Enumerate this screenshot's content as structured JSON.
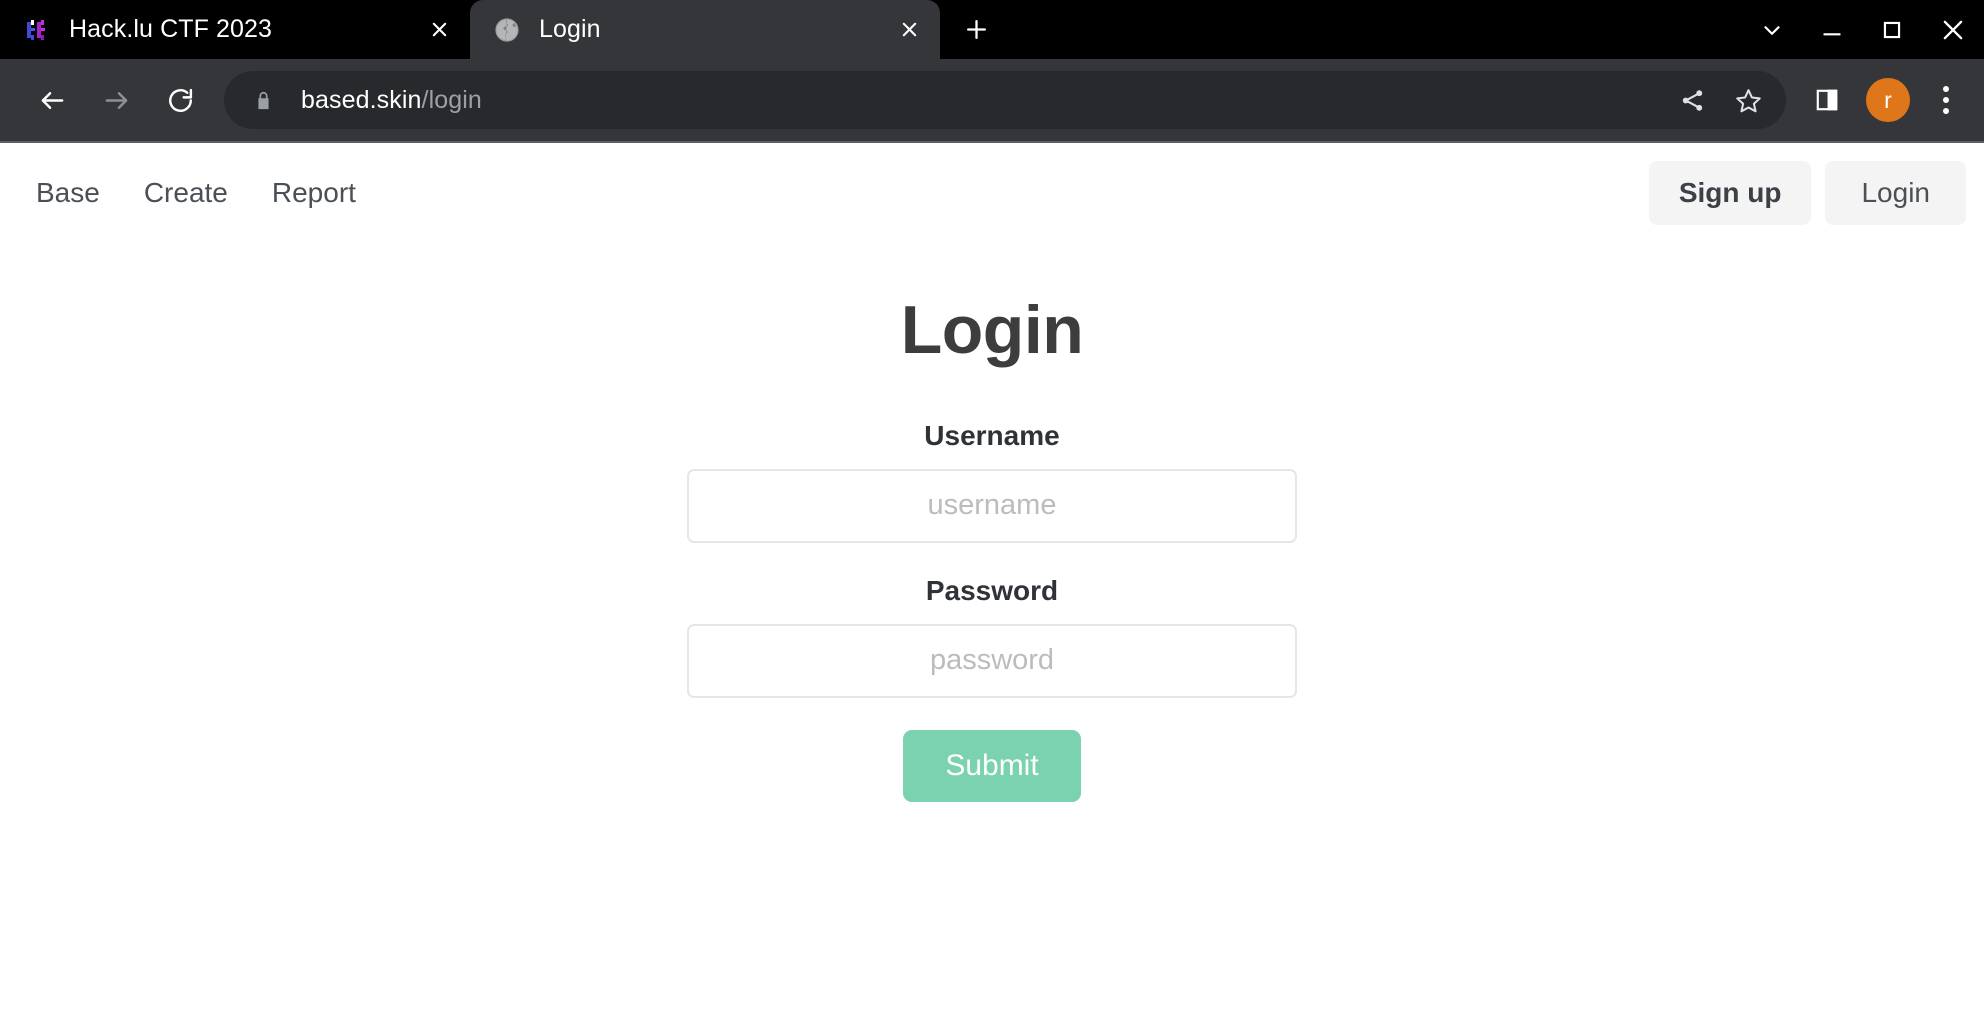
{
  "browser": {
    "tabs": [
      {
        "title": "Hack.lu CTF 2023",
        "favicon": "hacklu-logo-icon",
        "active": false,
        "close_label": "×"
      },
      {
        "title": "Login",
        "favicon": "globe-icon",
        "active": true,
        "close_label": "×"
      }
    ],
    "new_tab_label": "+",
    "window_controls": [
      {
        "name": "tab-search-chevron-icon",
        "glyph": "⌄"
      },
      {
        "name": "minimize-icon",
        "glyph": "—"
      },
      {
        "name": "maximize-icon",
        "glyph": "▢"
      },
      {
        "name": "close-window-icon",
        "glyph": "✕"
      }
    ],
    "toolbar": {
      "back_icon": "back-arrow-icon",
      "forward_icon": "forward-arrow-icon",
      "reload_icon": "reload-icon",
      "security_icon": "lock-icon",
      "url_domain": "based.skin",
      "url_path": "/login",
      "url_full": "based.skin/login",
      "share_icon": "share-icon",
      "bookmark_icon": "star-icon",
      "side_panel_icon": "side-panel-icon",
      "profile_initial": "r",
      "menu_icon": "three-dot-menu-icon"
    },
    "colors": {
      "tabstrip_bg": "#000000",
      "active_tab_bg": "#35363a",
      "toolbar_bg": "#35363a",
      "omnibox_bg": "#28292c",
      "avatar_bg": "#e0761a"
    }
  },
  "page": {
    "nav": {
      "links": [
        {
          "label": "Base"
        },
        {
          "label": "Create"
        },
        {
          "label": "Report"
        }
      ],
      "auth": {
        "signup_label": "Sign up",
        "login_label": "Login"
      }
    },
    "title": "Login",
    "form": {
      "username": {
        "label": "Username",
        "placeholder": "username",
        "value": ""
      },
      "password": {
        "label": "Password",
        "placeholder": "password",
        "value": ""
      },
      "submit_label": "Submit",
      "submit_color": "#7ad2ae"
    }
  }
}
